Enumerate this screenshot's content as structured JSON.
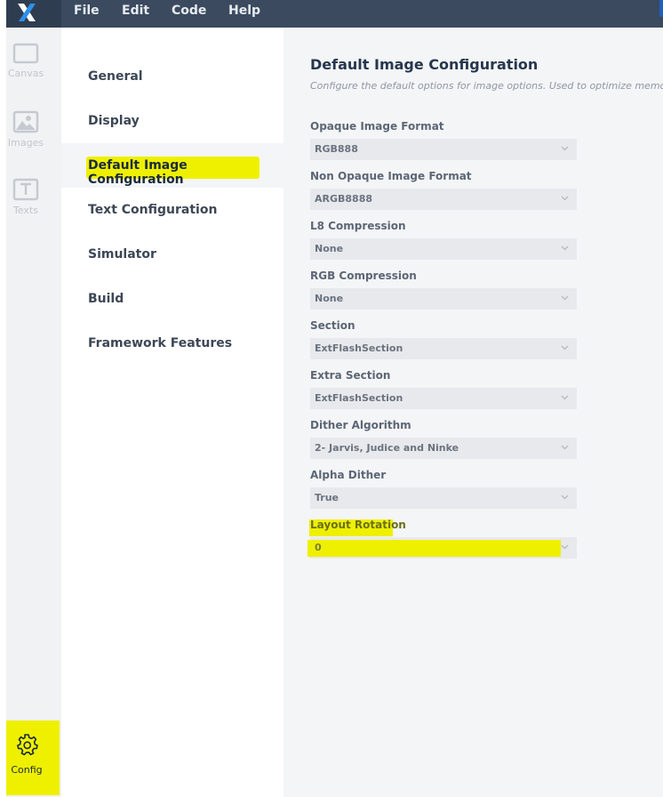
{
  "menubar": {
    "items": [
      "File",
      "Edit",
      "Code",
      "Help"
    ]
  },
  "rail": {
    "items": [
      {
        "label": "Canvas",
        "icon": "canvas-icon"
      },
      {
        "label": "Images",
        "icon": "image-icon"
      },
      {
        "label": "Texts",
        "icon": "text-icon"
      }
    ],
    "config": {
      "label": "Config",
      "icon": "gear-icon"
    }
  },
  "nav": {
    "items": [
      "General",
      "Display",
      "Default Image Configuration",
      "Text Configuration",
      "Simulator",
      "Build",
      "Framework Features"
    ],
    "selected": "Default Image Configuration"
  },
  "main": {
    "title": "Default Image Configuration",
    "subtitle": "Configure the default options for image options. Used to optimize memor",
    "fields": [
      {
        "label": "Opaque Image Format",
        "value": "RGB888"
      },
      {
        "label": "Non Opaque Image Format",
        "value": "ARGB8888"
      },
      {
        "label": "L8 Compression",
        "value": "None"
      },
      {
        "label": "RGB Compression",
        "value": "None"
      },
      {
        "label": "Section",
        "value": "ExtFlashSection"
      },
      {
        "label": "Extra Section",
        "value": "ExtFlashSection"
      },
      {
        "label": "Dither Algorithm",
        "value": "2- Jarvis, Judice and Ninke"
      },
      {
        "label": "Alpha Dither",
        "value": "True"
      },
      {
        "label": "Layout Rotation",
        "value": "0"
      }
    ]
  },
  "colors": {
    "menubar": "#3b4a5e",
    "highlight": "#eef000",
    "accent": "#1f5fbf"
  }
}
